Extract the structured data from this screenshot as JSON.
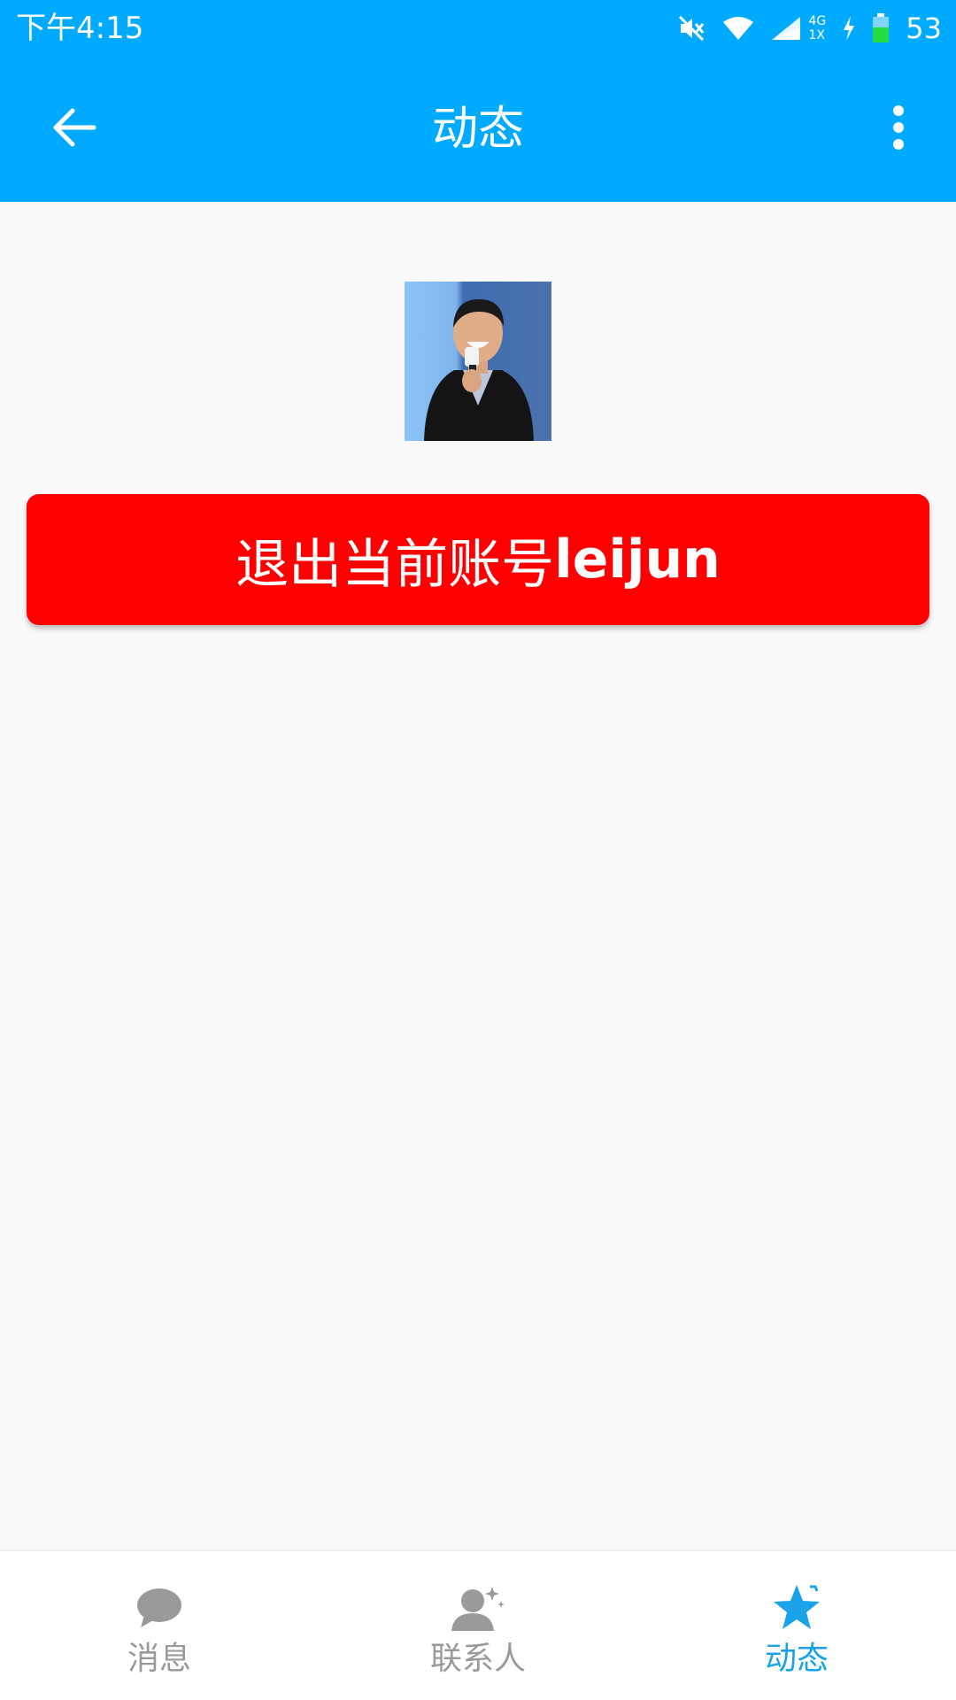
{
  "status_bar": {
    "time": "下午4:15",
    "network_top": "4G",
    "network_bottom": "1X",
    "battery": "53"
  },
  "toolbar": {
    "title": "动态",
    "back_icon": "arrow-left-icon",
    "menu_icon": "more-vert-icon"
  },
  "avatar": {
    "icon": "profile-photo"
  },
  "logout": {
    "label": "退出当前账号",
    "username": "leijun"
  },
  "bottom_nav": {
    "items": [
      {
        "label": "消息",
        "icon": "chat-bubble-icon",
        "active": false
      },
      {
        "label": "联系人",
        "icon": "contacts-icon",
        "active": false
      },
      {
        "label": "动态",
        "icon": "star-icon",
        "active": true
      }
    ]
  },
  "colors": {
    "primary": "#00aaff",
    "logout_button": "#ff0000",
    "nav_active": "#1aa3e8",
    "nav_inactive": "#9a9a9a"
  }
}
